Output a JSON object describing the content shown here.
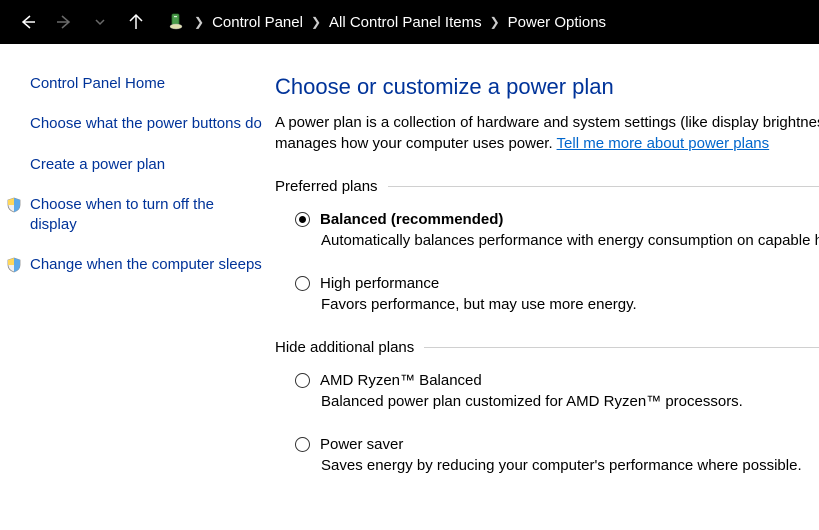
{
  "breadcrumb": {
    "items": [
      "Control Panel",
      "All Control Panel Items",
      "Power Options"
    ]
  },
  "sidebar": {
    "home": "Control Panel Home",
    "links": [
      "Choose what the power buttons do",
      "Create a power plan",
      "Choose when to turn off the display",
      "Change when the computer sleeps"
    ]
  },
  "main": {
    "title": "Choose or customize a power plan",
    "desc1": "A power plan is a collection of hardware and system settings (like display brightness, sleep, etc.) that",
    "desc2": "manages how your computer uses power. ",
    "learn_link": "Tell me more about power plans",
    "group1": "Preferred plans",
    "group2": "Hide additional plans",
    "plans": [
      {
        "name": "Balanced (recommended)",
        "desc": "Automatically balances performance with energy consumption on capable hardware.",
        "selected": true
      },
      {
        "name": "High performance",
        "desc": "Favors performance, but may use more energy.",
        "selected": false
      },
      {
        "name": "AMD Ryzen™ Balanced",
        "desc": "Balanced power plan customized for AMD Ryzen™ processors.",
        "selected": false
      },
      {
        "name": "Power saver",
        "desc": "Saves energy by reducing your computer's performance where possible.",
        "selected": false
      }
    ]
  }
}
